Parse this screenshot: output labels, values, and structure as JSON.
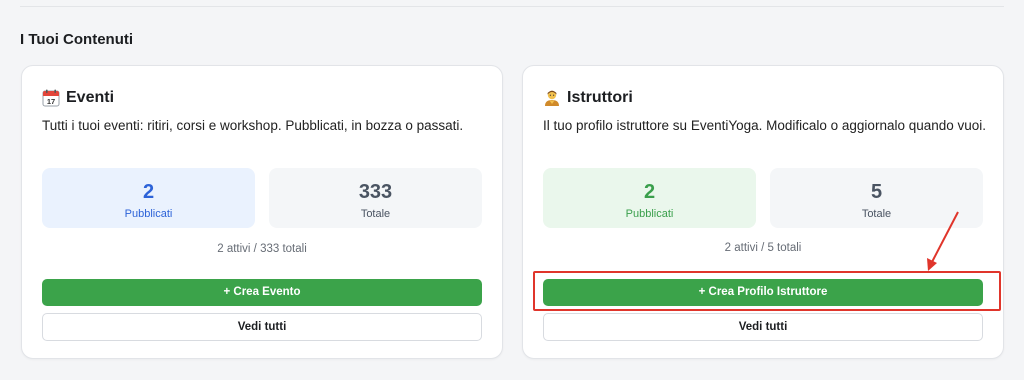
{
  "section": {
    "title": "I Tuoi Contenuti"
  },
  "cards": [
    {
      "icon": "calendar-icon",
      "title": "Eventi",
      "description": "Tutti i tuoi eventi: ritiri, corsi e workshop. Pubblicati, in bozza o passati.",
      "stats": [
        {
          "value": "2",
          "label": "Pubblicati"
        },
        {
          "value": "333",
          "label": "Totale"
        }
      ],
      "summary": "2 attivi / 333 totali",
      "primary_button": "+ Crea Evento",
      "secondary_button": "Vedi tutti"
    },
    {
      "icon": "yoga-teacher-icon",
      "title": "Istruttori",
      "description": "Il tuo profilo istruttore su EventiYoga. Modificalo o aggiornalo quando vuoi.",
      "stats": [
        {
          "value": "2",
          "label": "Pubblicati"
        },
        {
          "value": "5",
          "label": "Totale"
        }
      ],
      "summary": "2 attivi / 5 totali",
      "primary_button": "+ Crea Profilo Istruttore",
      "secondary_button": "Vedi tutti"
    }
  ],
  "colors": {
    "primary_green": "#3ba34a",
    "blue_accent": "#2d63d8",
    "green_accent": "#3a9f4c",
    "annotation_red": "#e0352b"
  }
}
